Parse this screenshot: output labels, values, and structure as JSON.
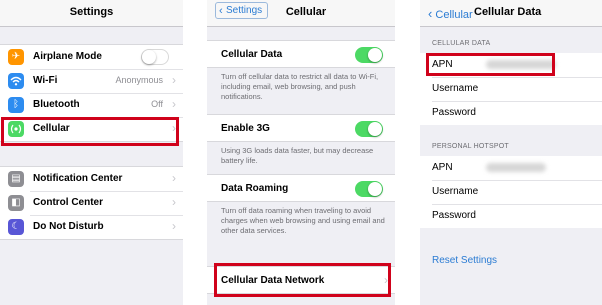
{
  "settings": {
    "title": "Settings",
    "rows_group1": [
      {
        "label": "Airplane Mode",
        "icon": "airplane-icon",
        "color": "#ff9500"
      },
      {
        "label": "Wi-Fi",
        "value": "Anonymous",
        "icon": "wifi-icon",
        "color": "#2d8cf0"
      },
      {
        "label": "Bluetooth",
        "value": "Off",
        "icon": "bluetooth-icon",
        "color": "#2d8cf0"
      },
      {
        "label": "Cellular",
        "icon": "cellular-icon",
        "color": "#4cd964"
      }
    ],
    "rows_group2": [
      {
        "label": "Notification Center",
        "icon": "notification-center-icon",
        "color": "#8e8e93"
      },
      {
        "label": "Control Center",
        "icon": "control-center-icon",
        "color": "#8e8e93"
      },
      {
        "label": "Do Not Disturb",
        "icon": "moon-icon",
        "color": "#5856d6"
      }
    ],
    "airplane_mode_on": false
  },
  "cellular": {
    "back": "Settings",
    "title": "Cellular",
    "cellular_data": {
      "label": "Cellular Data",
      "on": true,
      "footer": "Turn off cellular data to restrict all data to Wi-Fi, including email, web browsing, and push notifications."
    },
    "enable_3g": {
      "label": "Enable 3G",
      "on": true,
      "footer": "Using 3G loads data faster, but may decrease battery life."
    },
    "data_roaming": {
      "label": "Data Roaming",
      "on": true,
      "footer": "Turn off data roaming when traveling to avoid charges when web browsing and using email and other data services."
    },
    "network": {
      "label": "Cellular Data Network"
    }
  },
  "cellular_data": {
    "back": "Cellular",
    "title": "Cellular Data",
    "section1": "CELLULAR DATA",
    "section2": "PERSONAL HOTSPOT",
    "apn": "APN",
    "username": "Username",
    "password": "Password",
    "reset": "Reset Settings"
  },
  "highlight_color": "#d0021b"
}
